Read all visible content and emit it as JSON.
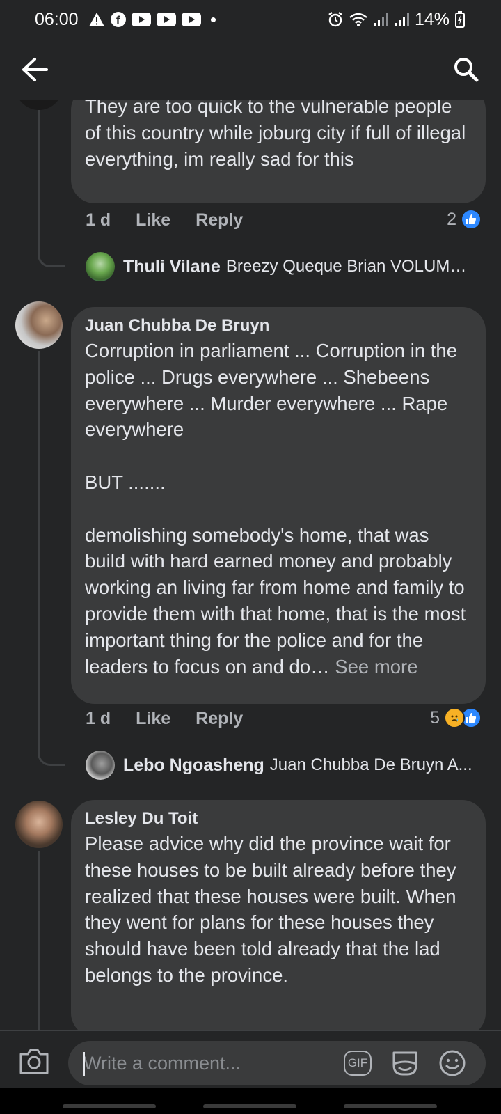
{
  "status_bar": {
    "time": "06:00",
    "notification_icons": [
      "warning-icon",
      "facebook-icon",
      "youtube-icon",
      "youtube-icon",
      "youtube-icon",
      "dot-icon"
    ],
    "battery": "14%",
    "system_icons": [
      "alarm-icon",
      "wifi-icon",
      "signal-icon",
      "signal-icon",
      "battery-charging-icon"
    ]
  },
  "header": {
    "back_icon": "arrow-left-icon",
    "search_icon": "search-icon"
  },
  "comments": [
    {
      "author": "",
      "text": "They are too quick to the vulnerable people of this country while joburg city if full of illegal everything, im really sad for this",
      "time": "1 d",
      "like_label": "Like",
      "reply_label": "Reply",
      "reaction_count": "2",
      "reactions": [
        "like"
      ],
      "reply_preview": {
        "name": "Thuli Vilane",
        "text": "Breezy Queque Brian VOLUME..."
      }
    },
    {
      "author": "Juan Chubba De Bruyn",
      "text": "Corruption in parliament ... Corruption in the police ... Drugs everywhere ... Shebeens everywhere ... Murder everywhere ... Rape everywhere\n\nBUT .......\n\ndemolishing somebody's home, that was build with hard earned money and probably working an living far from home and family to provide them with that home, that is the most important thing for the police and for the   leaders to focus on and do…",
      "see_more": "See more",
      "time": "1 d",
      "like_label": "Like",
      "reply_label": "Reply",
      "reaction_count": "5",
      "reactions": [
        "sad",
        "like"
      ],
      "reply_preview": {
        "name": "Lebo Ngoasheng",
        "text": "Juan Chubba De Bruyn A..."
      }
    },
    {
      "author": "Lesley Du Toit",
      "text": "Please advice why did the province wait for these houses to be built already before they realized that these houses were built. When they went for plans for these houses they should have been told already that the lad belongs to the province."
    }
  ],
  "composer": {
    "placeholder": "Write a comment...",
    "camera_icon": "camera-icon",
    "gif_label": "GIF",
    "sticker_icon": "sticker-icon",
    "emoji_icon": "emoji-icon"
  },
  "colors": {
    "background": "#242526",
    "bubble": "#3a3b3c",
    "text": "#e4e6eb",
    "secondary": "#b0b3b8",
    "like_blue": "#2d88ff"
  }
}
